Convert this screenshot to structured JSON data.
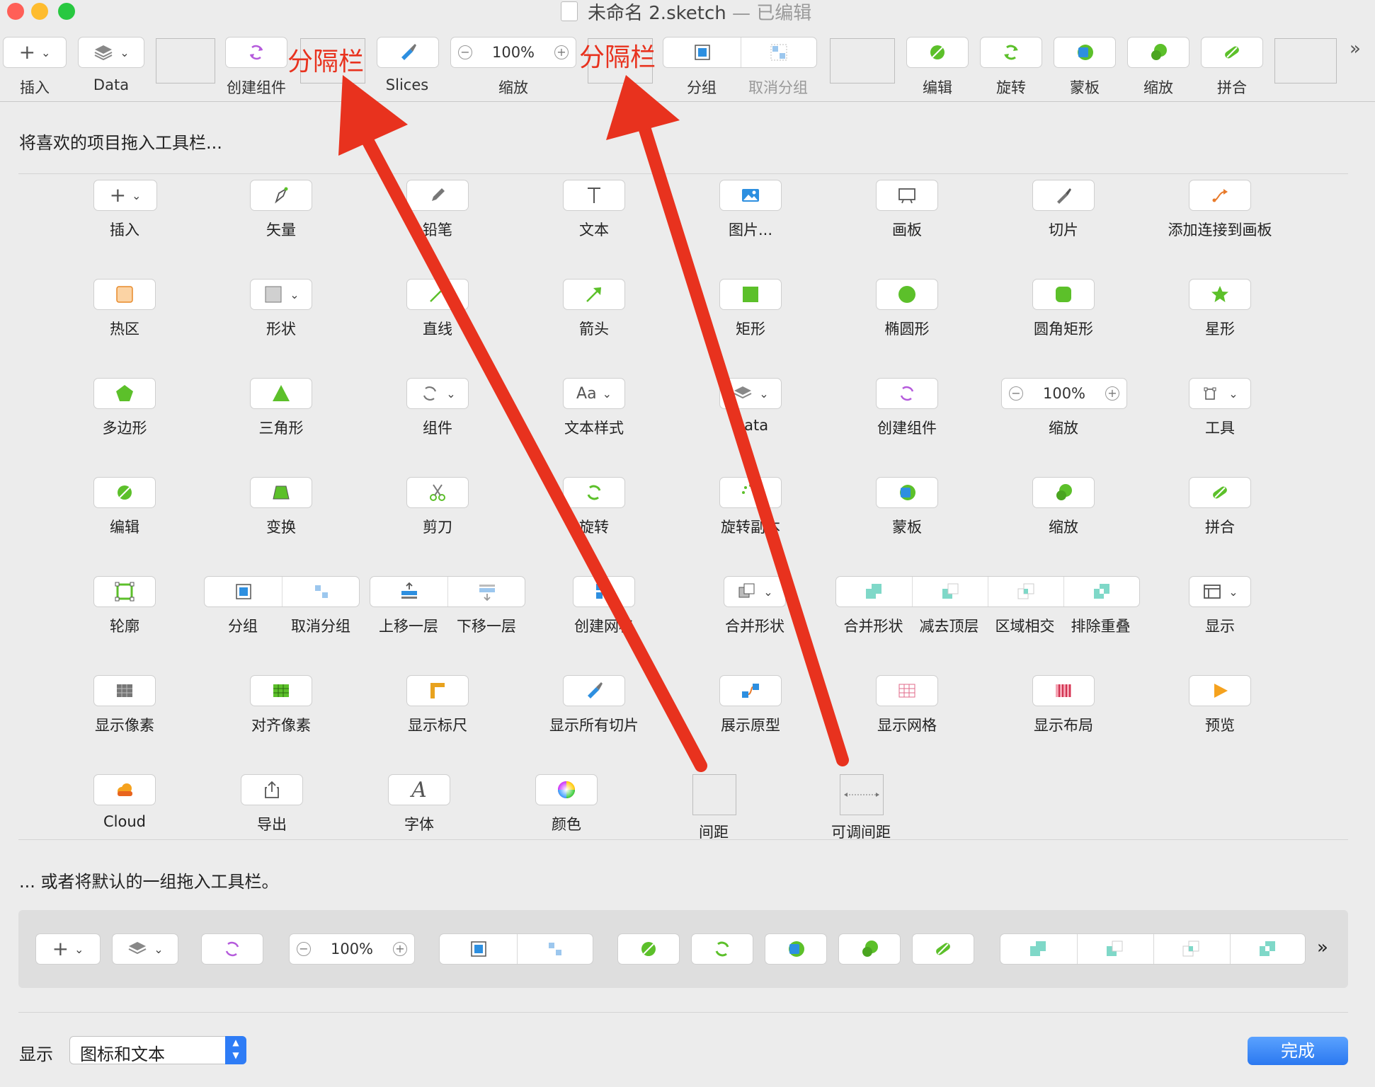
{
  "window": {
    "title": "未命名 2.sketch",
    "title_separator": " — ",
    "edited": "已编辑"
  },
  "toolbar": {
    "items": [
      {
        "label": "插入"
      },
      {
        "label": "Data"
      },
      {
        "label": "创建组件"
      },
      {
        "label": "Slices"
      },
      {
        "label": "缩放",
        "zoom_value": "100%"
      },
      {
        "label": "分组"
      },
      {
        "label": "取消分组"
      },
      {
        "label": "编辑"
      },
      {
        "label": "旋转"
      },
      {
        "label": "蒙板"
      },
      {
        "label": "缩放"
      },
      {
        "label": "拼合"
      }
    ],
    "overflow": "»"
  },
  "annotations": {
    "separator_label_1": "分隔栏",
    "separator_label_2": "分隔栏",
    "arrow_color": "#e8321e"
  },
  "palette": {
    "heading": "将喜欢的项目拖入工具栏...",
    "rows": [
      [
        "插入",
        "矢量",
        "铅笔",
        "文本",
        "图片...",
        "画板",
        "切片",
        "添加连接到画板"
      ],
      [
        "热区",
        "形状",
        "直线",
        "箭头",
        "矩形",
        "椭圆形",
        "圆角矩形",
        "星形"
      ],
      [
        "多边形",
        "三角形",
        "组件",
        "文本样式",
        "Data",
        "创建组件",
        "缩放",
        "工具"
      ],
      [
        "编辑",
        "变换",
        "剪刀",
        "旋转",
        "旋转副本",
        "蒙板",
        "缩放",
        "拼合"
      ],
      [
        "轮廓",
        "分组",
        "取消分组",
        "上移一层",
        "下移一层",
        "创建网格",
        "合并形状",
        "合并形状",
        "减去顶层",
        "区域相交",
        "排除重叠",
        "显示"
      ],
      [
        "显示像素",
        "对齐像素",
        "显示标尺",
        "显示所有切片",
        "展示原型",
        "显示网格",
        "显示布局",
        "预览"
      ],
      [
        "Cloud",
        "导出",
        "字体",
        "颜色",
        "间距",
        "可调间距"
      ]
    ],
    "zoom_value": "100%",
    "text_style_glyph": "Aa",
    "font_glyph": "A"
  },
  "defaults": {
    "heading": "... 或者将默认的一组拖入工具栏。",
    "zoom_value": "100%",
    "overflow": "»"
  },
  "footer": {
    "show_label": "显示",
    "show_value": "图标和文本",
    "done_label": "完成"
  },
  "colors": {
    "accent": "#2e7cf6",
    "green": "#5cc02a",
    "purple": "#b55bdc",
    "blue": "#2d8fe0"
  }
}
